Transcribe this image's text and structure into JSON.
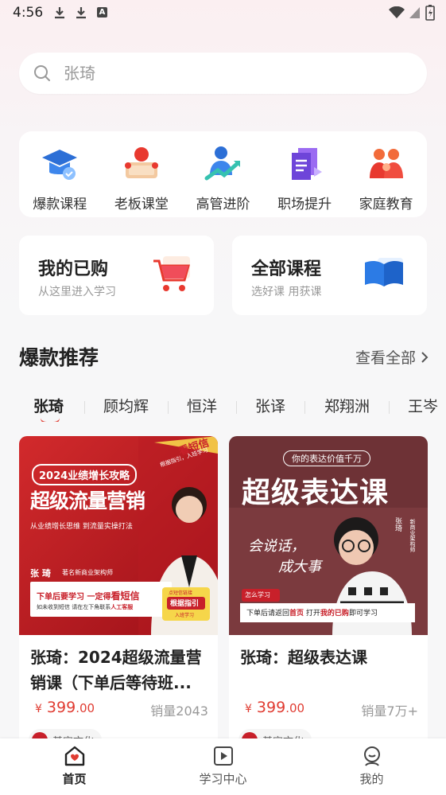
{
  "status_bar": {
    "time": "4:56",
    "badge_letter": "A"
  },
  "search": {
    "placeholder": "张琦"
  },
  "categories": [
    {
      "label": "爆款课程",
      "icon": "graduation-cap-icon"
    },
    {
      "label": "老板课堂",
      "icon": "boss-lecture-icon"
    },
    {
      "label": "高管进阶",
      "icon": "executive-growth-icon"
    },
    {
      "label": "职场提升",
      "icon": "career-books-icon"
    },
    {
      "label": "家庭教育",
      "icon": "family-icon"
    }
  ],
  "promos": [
    {
      "title": "我的已购",
      "subtitle": "从这里进入学习",
      "icon": "shopping-cart-icon"
    },
    {
      "title": "全部课程",
      "subtitle": "选好课 用获课",
      "icon": "open-book-icon"
    }
  ],
  "section": {
    "title": "爆款推荐",
    "more": "查看全部"
  },
  "teacher_tabs": [
    "张琦",
    "顾均辉",
    "恒洋",
    "张译",
    "郑翔洲",
    "王岑"
  ],
  "courses": [
    {
      "title": "张琦：2024超级流量营销课（下单后等待班...",
      "price_currency": "¥",
      "price_int": "399",
      "price_dec": ".00",
      "sales": "销量2043",
      "publisher": "基宝文化",
      "cover": {
        "ribbon": "看短信",
        "ribbon_sub": "根据指引，入班学习",
        "badge": "2024业绩增长攻略",
        "headline": "超级流量营销",
        "sub": "从业绩增长思维 到流量实操打法",
        "author": "张 琦",
        "author_desc": "著名新商业架构师",
        "notice1_a": "下单后要学习 一定得",
        "notice1_b": "看短信",
        "notice2_a": "如未收到短信 请在左下角联系",
        "notice2_b": "人工客服",
        "stamp_top": "点短信链接",
        "stamp_mid": "根据指引",
        "stamp_bot": "入班学习"
      }
    },
    {
      "title": "张琦：超级表达课",
      "price_currency": "¥",
      "price_int": "399",
      "price_dec": ".00",
      "sales": "销量7万+",
      "publisher": "基宝文化",
      "cover": {
        "tag": "你的表达价值千万",
        "headline": "超级表达课",
        "calligraphy_1": "会说话，",
        "calligraphy_2": "成大事",
        "author": "张琦",
        "author_desc": "新商业架构师",
        "how": "怎么学习",
        "notice_a": "下单后请返回",
        "notice_b": "首页",
        "notice_c": "打开",
        "notice_d": "我的已购",
        "notice_e": "即可学习"
      }
    }
  ],
  "bottom_nav": [
    {
      "label": "首页",
      "icon": "home-icon",
      "active": true
    },
    {
      "label": "学习中心",
      "icon": "play-book-icon",
      "active": false
    },
    {
      "label": "我的",
      "icon": "profile-icon",
      "active": false
    }
  ],
  "colors": {
    "accent": "#e03c32",
    "brand_red": "#c8202a"
  }
}
